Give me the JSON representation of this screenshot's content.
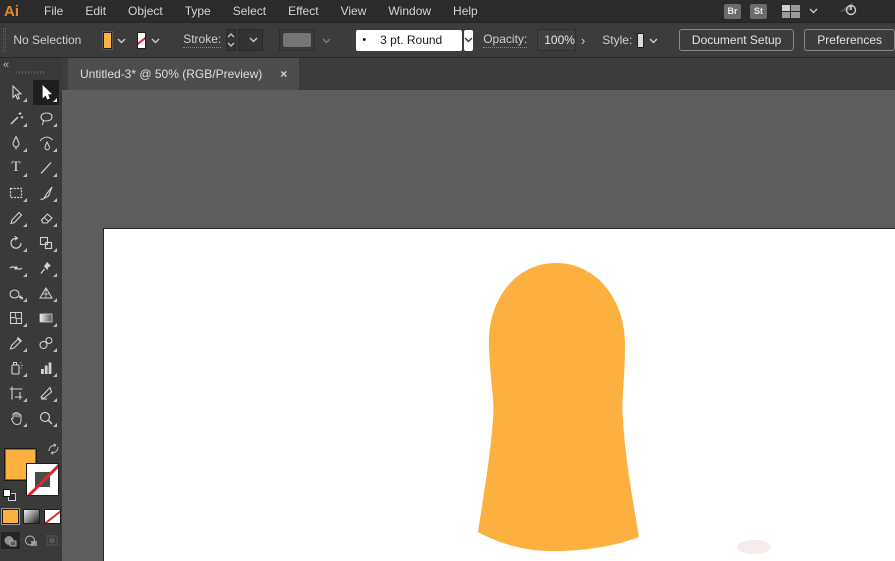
{
  "app_badge": "Ai",
  "menubar": {
    "items": [
      "File",
      "Edit",
      "Object",
      "Type",
      "Select",
      "Effect",
      "View",
      "Window",
      "Help"
    ],
    "bridge_badge": "Br",
    "stock_badge": "St"
  },
  "control_bar": {
    "selection_status": "No Selection",
    "fill_color": "#FBB03F",
    "stroke_label": "Stroke:",
    "brush_bullet": "•",
    "brush_name": "3 pt. Round",
    "opacity_label": "Opacity:",
    "opacity_value": "100%",
    "opacity_expand": "›",
    "style_label": "Style:",
    "document_setup": "Document Setup",
    "preferences": "Preferences"
  },
  "document_tab": {
    "title": "Untitled-3* @ 50% (RGB/Preview)",
    "close_glyph": "×"
  },
  "toolbar": {
    "collapse_glyph": "«",
    "type_tool_glyph": "T",
    "selected_tool": "direct-selection-tool",
    "tools": [
      "selection-tool",
      "direct-selection-tool",
      "magic-wand-tool",
      "lasso-tool",
      "pen-tool",
      "curvature-tool",
      "type-tool",
      "line-segment-tool",
      "rectangle-tool",
      "paintbrush-tool",
      "pencil-tool",
      "eraser-tool",
      "rotate-tool",
      "scale-tool",
      "width-tool",
      "puppet-warp-tool",
      "shape-builder-tool",
      "perspective-grid-tool",
      "mesh-tool",
      "gradient-tool",
      "eyedropper-tool",
      "blend-tool",
      "symbol-sprayer-tool",
      "column-graph-tool",
      "artboard-tool",
      "slice-tool",
      "hand-tool",
      "zoom-tool"
    ],
    "drawing_modes": [
      "draw-normal",
      "draw-behind",
      "draw-inside"
    ],
    "active_drawing_mode": "draw-normal"
  },
  "canvas": {
    "zoom_percent": "50%",
    "color_mode": "RGB/Preview",
    "shape_fill": "#FBB03F"
  },
  "colors": {
    "accent_orange": "#FBB03F",
    "menubar_bg": "#2B2B2B",
    "panel_bg": "#3A3A3A",
    "pasteboard": "#5E5E5E",
    "stroke_none_red": "#D9272E"
  }
}
